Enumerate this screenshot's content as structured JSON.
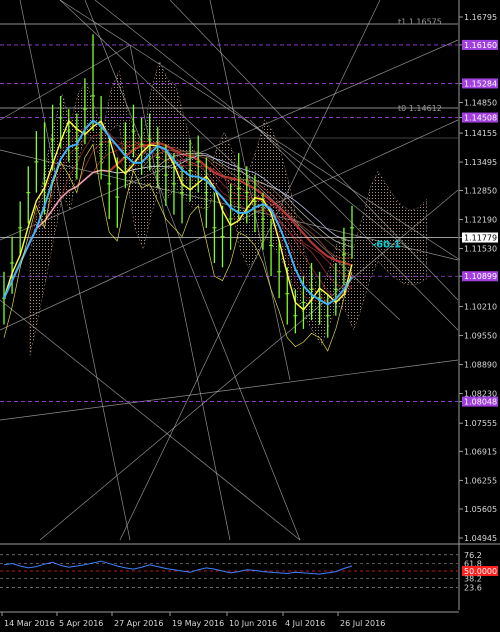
{
  "chart_data": {
    "type": "line",
    "title": "",
    "main_panel": {
      "price_axis_ticks": [
        "1.16795",
        "1.16160",
        "1.15284",
        "1.14850",
        "1.14508",
        "1.14155",
        "1.13495",
        "1.12850",
        "1.12190",
        "1.11779",
        "1.11530",
        "1.10899",
        "1.10210",
        "1.09550",
        "1.08890",
        "1.08230",
        "1.08048",
        "1.07555",
        "1.06915",
        "1.06255",
        "1.05605",
        "1.04945"
      ],
      "price_axis_values": [
        1.16795,
        1.1616,
        1.15284,
        1.1485,
        1.14508,
        1.14155,
        1.13495,
        1.1285,
        1.1219,
        1.11779,
        1.1153,
        1.10899,
        1.1021,
        1.0955,
        1.0889,
        1.0823,
        1.08048,
        1.07555,
        1.06915,
        1.06255,
        1.05605,
        1.04945
      ],
      "highlighted_levels": [
        {
          "label": "1.16160",
          "value": 1.1616,
          "color": "#a040e0"
        },
        {
          "label": "1.15284",
          "value": 1.15284,
          "color": "#a040e0"
        },
        {
          "label": "1.14508",
          "value": 1.14508,
          "color": "#a040e0"
        },
        {
          "label": "1.11779",
          "value": 1.11779,
          "color": "#000000",
          "box": "#ffffff",
          "text_color": "#000000"
        },
        {
          "label": "1.10899",
          "value": 1.10899,
          "color": "#a040e0"
        },
        {
          "label": "1.08048",
          "value": 1.08048,
          "color": "#a040e0"
        }
      ],
      "annotations": [
        {
          "text": "t1 1.16575",
          "value": 1.16575
        },
        {
          "text": "t0 1.14612",
          "value": 1.14612
        }
      ],
      "fib_label": "-60.1",
      "price_series": [
        1.104,
        1.112,
        1.12,
        1.128,
        1.135,
        1.13,
        1.14,
        1.145,
        1.142,
        1.138,
        1.147,
        1.15,
        1.139,
        1.13,
        1.127,
        1.136,
        1.142,
        1.139,
        1.14,
        1.136,
        1.132,
        1.13,
        1.128,
        1.133,
        1.135,
        1.128,
        1.12,
        1.118,
        1.122,
        1.129,
        1.128,
        1.126,
        1.122,
        1.116,
        1.11,
        1.105,
        1.1,
        1.103,
        1.106,
        1.104,
        1.1,
        1.106,
        1.114,
        1.12
      ],
      "price_high": [
        1.11,
        1.118,
        1.126,
        1.134,
        1.142,
        1.144,
        1.148,
        1.15,
        1.147,
        1.146,
        1.154,
        1.164,
        1.15,
        1.14,
        1.136,
        1.144,
        1.148,
        1.145,
        1.146,
        1.143,
        1.139,
        1.137,
        1.134,
        1.14,
        1.141,
        1.136,
        1.128,
        1.125,
        1.13,
        1.137,
        1.134,
        1.132,
        1.128,
        1.122,
        1.117,
        1.111,
        1.106,
        1.109,
        1.112,
        1.11,
        1.105,
        1.112,
        1.12,
        1.125
      ],
      "price_low": [
        1.098,
        1.105,
        1.114,
        1.121,
        1.128,
        1.123,
        1.133,
        1.138,
        1.135,
        1.131,
        1.139,
        1.142,
        1.131,
        1.122,
        1.12,
        1.129,
        1.136,
        1.132,
        1.133,
        1.129,
        1.125,
        1.123,
        1.121,
        1.126,
        1.128,
        1.12,
        1.112,
        1.111,
        1.115,
        1.122,
        1.121,
        1.119,
        1.115,
        1.109,
        1.104,
        1.098,
        1.096,
        1.097,
        1.099,
        1.098,
        1.095,
        1.1,
        1.107,
        1.113
      ]
    },
    "indicator_panel": {
      "levels": [
        {
          "label": "76.2",
          "value": 76.2
        },
        {
          "label": "61.8",
          "value": 61.8
        },
        {
          "label": "50.0000",
          "value": 50.0,
          "color": "#ff2020",
          "box": "#ff2020"
        },
        {
          "label": "38.2",
          "value": 38.2
        },
        {
          "label": "23.6",
          "value": 23.6
        }
      ],
      "series": [
        60,
        62,
        58,
        55,
        57,
        61,
        64,
        59,
        56,
        58,
        60,
        63,
        66,
        62,
        58,
        55,
        53,
        56,
        60,
        57,
        54,
        52,
        50,
        48,
        52,
        55,
        53,
        50,
        47,
        49,
        52,
        51,
        49,
        48,
        47,
        46,
        48,
        47,
        46,
        45,
        47,
        49,
        54,
        58
      ]
    },
    "x_axis_labels": [
      "14 Mar 2016",
      "5 Apr 2016",
      "27 Apr 2016",
      "19 May 2016",
      "10 Jun 2016",
      "4 Jul 2016",
      "26 Jul 2016"
    ],
    "grid": false,
    "colors": {
      "background": "#000000",
      "price_bars": "#80ff20",
      "fast_ma": "#40b0ff",
      "slow_ma": "#ff2020",
      "yellow_ma": "#ffff40",
      "ichimoku_cloud": "#c0a090",
      "level_line": "#a040e0",
      "indicator_line": "#4080ff"
    }
  }
}
